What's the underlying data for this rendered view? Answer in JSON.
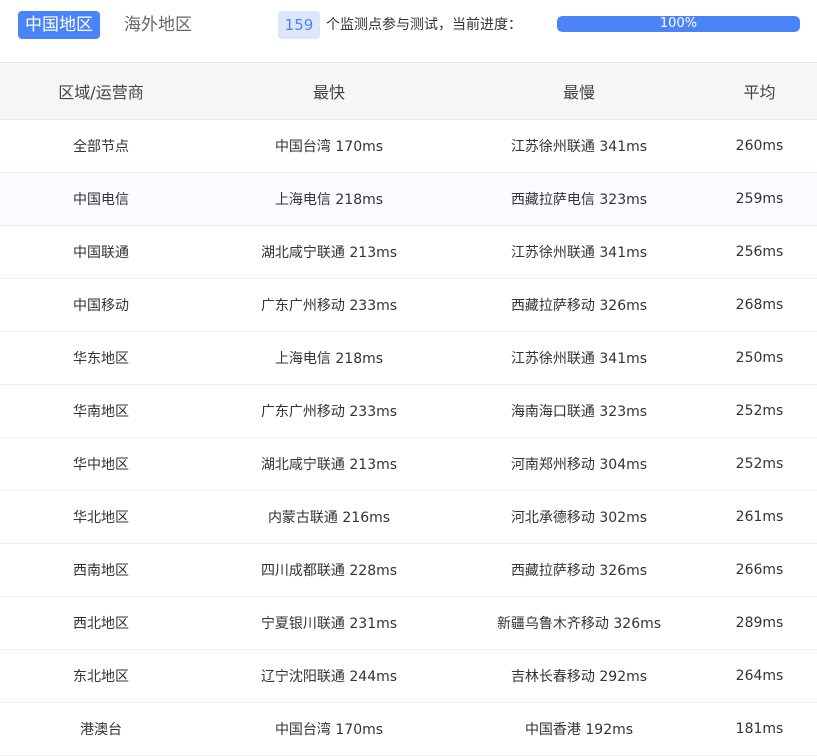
{
  "tabs": [
    "中国地区",
    "海外地区"
  ],
  "status": {
    "count": "159",
    "text": "个监测点参与测试，当前进度：",
    "progress": 100,
    "progress_label": "100%"
  },
  "table": {
    "headers": [
      "区域/运营商",
      "最快",
      "最慢",
      "平均"
    ],
    "rows": [
      [
        "全部节点",
        "中国台湾 170ms",
        "江苏徐州联通 341ms",
        "260ms"
      ],
      [
        "中国电信",
        "上海电信 218ms",
        "西藏拉萨电信 323ms",
        "259ms"
      ],
      [
        "中国联通",
        "湖北咸宁联通 213ms",
        "江苏徐州联通 341ms",
        "256ms"
      ],
      [
        "中国移动",
        "广东广州移动 233ms",
        "西藏拉萨移动 326ms",
        "268ms"
      ],
      [
        "华东地区",
        "上海电信 218ms",
        "江苏徐州联通 341ms",
        "250ms"
      ],
      [
        "华南地区",
        "广东广州移动 233ms",
        "海南海口联通 323ms",
        "252ms"
      ],
      [
        "华中地区",
        "湖北咸宁联通 213ms",
        "河南郑州移动 304ms",
        "252ms"
      ],
      [
        "华北地区",
        "内蒙古联通 216ms",
        "河北承德移动 302ms",
        "261ms"
      ],
      [
        "西南地区",
        "四川成都联通 228ms",
        "西藏拉萨移动 326ms",
        "266ms"
      ],
      [
        "西北地区",
        "宁夏银川联通 231ms",
        "新疆乌鲁木齐移动 326ms",
        "289ms"
      ],
      [
        "东北地区",
        "辽宁沈阳联通 244ms",
        "吉林长春移动 292ms",
        "264ms"
      ],
      [
        "港澳台",
        "中国台湾 170ms",
        "中国香港 192ms",
        "181ms"
      ]
    ]
  }
}
